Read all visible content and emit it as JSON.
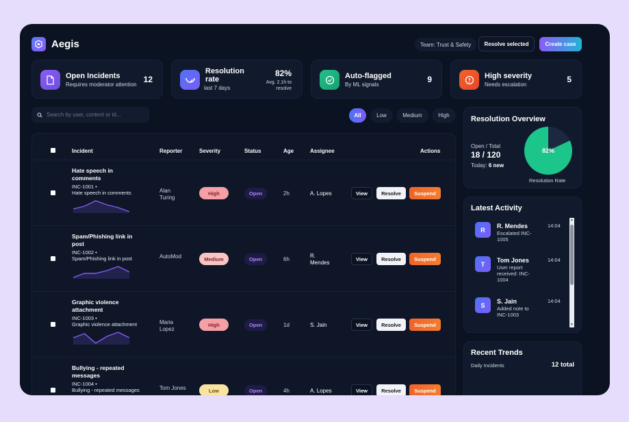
{
  "app": {
    "name": "Aegis"
  },
  "header": {
    "team": "Team: Trust & Safety",
    "resolve_selected": "Resolve selected",
    "create_case": "Create case"
  },
  "stats": [
    {
      "title": "Open Incidents",
      "sub": "Requires moderator attention",
      "value": "12",
      "icon": "document-icon",
      "color": "#7c5cf6"
    },
    {
      "title": "Resolution rate",
      "sub": "last 7 days",
      "value": "82%",
      "note": "Avg. 2.1h to resolve",
      "icon": "gauge-icon",
      "color": "#4f73f5"
    },
    {
      "title": "Auto-flagged",
      "sub": "By ML signals",
      "value": "9",
      "icon": "check-circle-icon",
      "color": "#22c08a"
    },
    {
      "title": "High severity",
      "sub": "Needs escalation",
      "value": "5",
      "icon": "alert-icon",
      "color": "#f0642a"
    }
  ],
  "search": {
    "placeholder": "Search by user, content or id..."
  },
  "filters": [
    "All",
    "Low",
    "Medium",
    "High"
  ],
  "table": {
    "headers": {
      "incident": "Incident",
      "reporter": "Reporter",
      "severity": "Severity",
      "status": "Status",
      "age": "Age",
      "assignee": "Assignee",
      "actions": "Actions"
    },
    "actions": {
      "view": "View",
      "resolve": "Resolve",
      "suspend": "Suspend"
    },
    "rows": [
      {
        "title": "Hate speech in comments",
        "id": "INC-1001 •",
        "desc": "Hate speech in comments",
        "reporter": "Alan Turing",
        "severity": "High",
        "status": "Open",
        "age": "2h",
        "assignee": "A. Lopes",
        "trend": [
          3,
          5,
          9,
          6,
          4,
          1
        ]
      },
      {
        "title": "Spam/Phishing link in post",
        "id": "INC-1002 •",
        "desc": "Spam/Phishing link in post",
        "reporter": "AutoMod",
        "severity": "Medium",
        "status": "Open",
        "age": "6h",
        "assignee": "R. Mendes",
        "trend": [
          2,
          5,
          5,
          7,
          10,
          6
        ]
      },
      {
        "title": "Graphic violence attachment",
        "id": "INC-1003 •",
        "desc": "Graphic violence attachment",
        "reporter": "Maria Lopez",
        "severity": "High",
        "status": "Open",
        "age": "1d",
        "assignee": "S. Jain",
        "trend": [
          6,
          9,
          2,
          7,
          10,
          6
        ]
      },
      {
        "title": "Bullying - repeated messages",
        "id": "INC-1004 •",
        "desc": "Bullying - repeated messages",
        "reporter": "Tom Jones",
        "severity": "Low",
        "status": "Open",
        "age": "4h",
        "assignee": "A. Lopes",
        "trend": [
          4,
          6,
          3,
          7,
          5,
          4
        ]
      }
    ]
  },
  "overview": {
    "title": "Resolution Overview",
    "open_total_label": "Open / Total",
    "open_total": "18 / 120",
    "today_label": "Today:",
    "today_value": "6 new",
    "percent": 82,
    "percent_label": "82%",
    "caption": "Resolution Rate",
    "color_resolved": "#1cc58a",
    "color_open": "#1c2740"
  },
  "activity": {
    "title": "Latest Activity",
    "items": [
      {
        "initial": "R",
        "name": "R. Mendes",
        "time": "14:04",
        "text": "Escalated INC-1005"
      },
      {
        "initial": "T",
        "name": "Tom Jones",
        "time": "14:04",
        "text": "User report received: INC-1004"
      },
      {
        "initial": "S",
        "name": "S. Jain",
        "time": "14:04",
        "text": "Added note to INC-1003"
      }
    ]
  },
  "trends": {
    "title": "Recent Trends",
    "label": "Daily Incidents",
    "total": "12 total"
  }
}
